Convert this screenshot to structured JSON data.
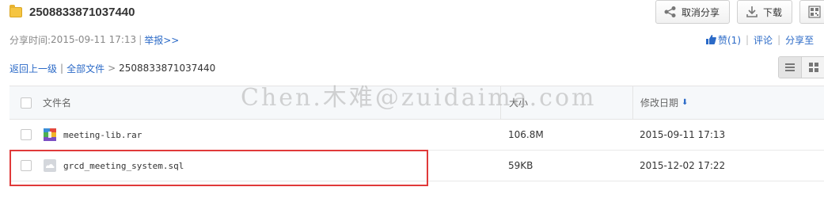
{
  "share": {
    "title": "2508833871037440",
    "time_label": "分享时间:",
    "time_value": "2015-09-11 17:13",
    "separator": "|",
    "report_link": "举报>>"
  },
  "toolbar": {
    "cancel_share_label": "取消分享",
    "download_label": "下载",
    "cancel_share_icon": "share-icon",
    "download_icon": "download-icon",
    "extra_icon": "qrcode-icon"
  },
  "social": {
    "like_label": "赞(1)",
    "comment_label": "评论",
    "share_to_label": "分享至",
    "separator": "|",
    "like_icon": "thumbs-up-icon"
  },
  "breadcrumb": {
    "back_label": "返回上一级",
    "all_files_label": "全部文件",
    "current_label": "2508833871037440",
    "separator_pipe": "|",
    "separator_arrow": ">"
  },
  "view": {
    "list_icon": "list-view-icon",
    "grid_icon": "grid-view-icon",
    "active": "list"
  },
  "table": {
    "headers": {
      "name": "文件名",
      "size": "大小",
      "date": "修改日期",
      "date_sort_icon": "sort-down-arrow-icon"
    },
    "rows": [
      {
        "name": "meeting-lib.rar",
        "size": "106.8M",
        "date": "2015-09-11 17:13",
        "icon": "rar-archive-icon"
      },
      {
        "name": "grcd_meeting_system.sql",
        "size": "59KB",
        "date": "2015-12-02 17:22",
        "icon": "generic-file-icon"
      }
    ]
  },
  "watermark": {
    "text": "Chen.木难@zuidaima.com"
  },
  "colors": {
    "link": "#2b6ac7",
    "highlight_border": "#e03a3a",
    "folder": "#f5c542",
    "header_bg": "#f6f8fa"
  }
}
